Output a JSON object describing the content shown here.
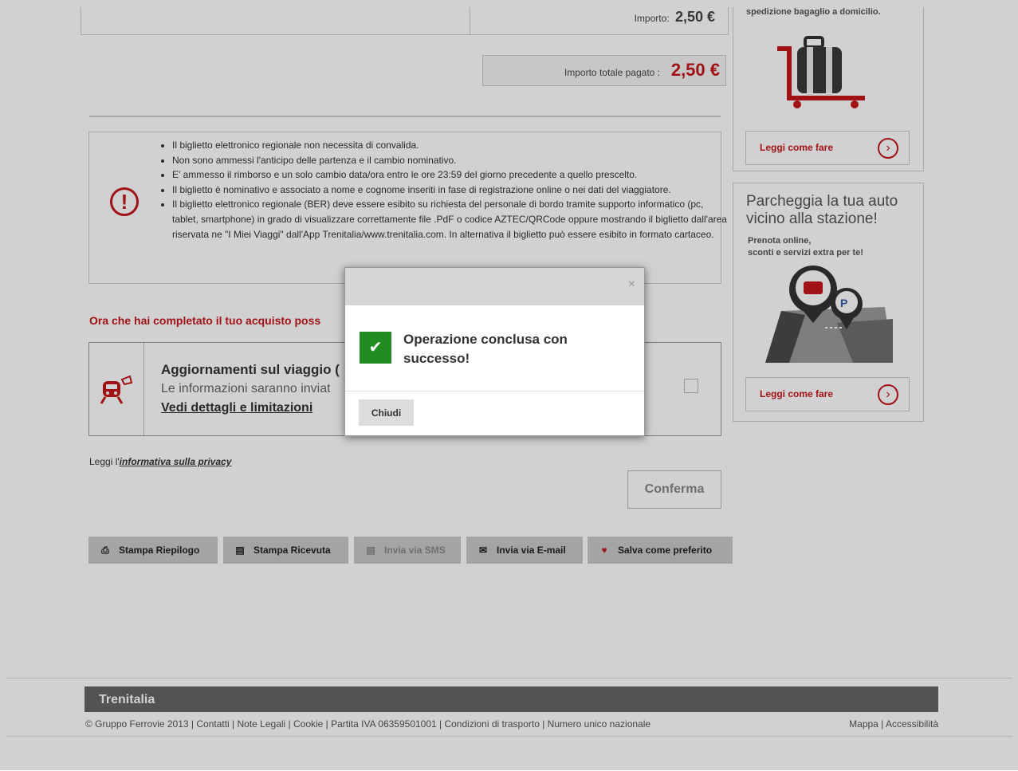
{
  "summary": {
    "amount_label": "Importo:",
    "amount_value": "2,50 €"
  },
  "total": {
    "label": "Importo totale pagato :",
    "value": "2,50 €"
  },
  "info": {
    "items": [
      "Il biglietto elettronico regionale non necessita di convalida.",
      "Non sono ammessi l'anticipo delle partenza e il cambio nominativo.",
      "E' ammesso il rimborso e un solo cambio data/ora entro le ore 23:59 del giorno precedente a quello prescelto.",
      "Il biglietto è nominativo e associato a nome e cognome inseriti in fase di registrazione online o nei dati del viaggiatore.",
      "Il biglietto elettronico regionale (BER) deve essere esibito su richiesta del personale di bordo tramite supporto informatico (pc, tablet, smartphone) in grado di visualizzare correttamente file .PdF o codice AZTEC/QRCode oppure mostrando il biglietto dall'area riservata ne \"I Miei Viaggi\" dall'App Trenitalia/www.trenitalia.com. In alternativa il biglietto può essere esibito in formato cartaceo."
    ]
  },
  "promo_heading": "Ora che hai completato il tuo acquisto poss",
  "updates": {
    "title": "Aggiornamenti sul viaggio (",
    "subtitle": "Le informazioni saranno inviat",
    "details_link": "Vedi dettagli e limitazioni"
  },
  "privacy": {
    "prefix": "Leggi l'",
    "link": "informativa sulla privacy"
  },
  "confirm_label": "Conferma",
  "actions": [
    {
      "label": "Stampa Riepilogo",
      "icon": "printer-icon",
      "enabled": true
    },
    {
      "label": "Stampa Ricevuta",
      "icon": "receipt-icon",
      "enabled": true
    },
    {
      "label": "Invia via SMS",
      "icon": "sms-icon",
      "enabled": false
    },
    {
      "label": "Invia via E-mail",
      "icon": "envelope-icon",
      "enabled": true
    },
    {
      "label": "Salva come preferito",
      "icon": "heart-icon",
      "enabled": true
    }
  ],
  "sidebar": {
    "luggage": {
      "title": "spedizione bagaglio a domicilio.",
      "link": "Leggi come fare"
    },
    "parking": {
      "title": "Parcheggia la tua auto vicino alla stazione!",
      "subtitle_line1": "Prenota online,",
      "subtitle_line2": "sconti e servizi extra per te!",
      "link": "Leggi come fare"
    }
  },
  "footer": {
    "brand": "Trenitalia",
    "links": "© Gruppo Ferrovie 2013  |  Contatti  |  Note Legali  |  Cookie  |  Partita IVA 06359501001  |  Condizioni di trasporto |  Numero unico nazionale",
    "right_links": "Mappa  |  Accessibilità"
  },
  "modal": {
    "close_symbol": "×",
    "message": "Operazione conclusa con successo!",
    "button": "Chiudi"
  },
  "colors": {
    "accent_red": "#c4161c",
    "success_green": "#228b22"
  }
}
